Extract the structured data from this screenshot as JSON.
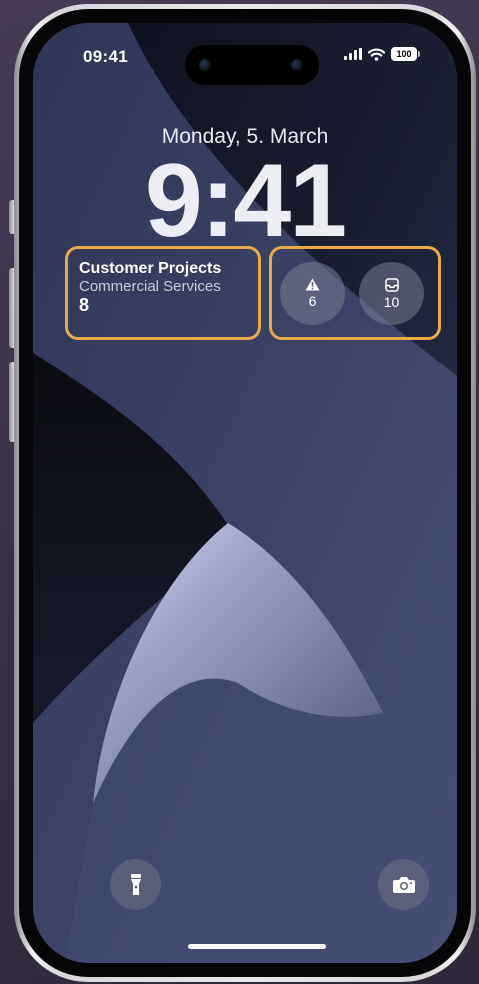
{
  "status_bar": {
    "time": "09:41",
    "battery": "100"
  },
  "lock_screen": {
    "date": "Monday, 5. March",
    "time": "9:41"
  },
  "widgets": {
    "projects": {
      "title": "Customer Projects",
      "subtitle": "Commercial Services",
      "count": "8"
    },
    "alerts": {
      "icon": "warning-icon",
      "value": "6"
    },
    "inbox": {
      "icon": "inbox-tray-icon",
      "value": "10"
    }
  },
  "quick_actions": {
    "left_icon": "flashlight-icon",
    "right_icon": "camera-icon"
  },
  "colors": {
    "highlight_border": "#e9a94d",
    "background": "#3b3148"
  }
}
